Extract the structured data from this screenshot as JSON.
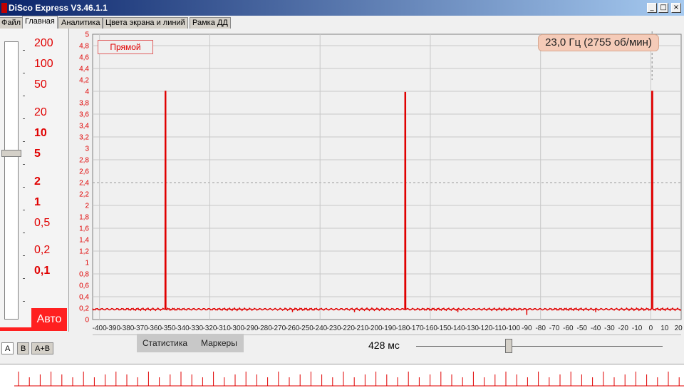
{
  "window": {
    "title": "DiSco Express V3.46.1.1",
    "min": "_",
    "max": "□",
    "close": "×"
  },
  "tabs": [
    {
      "label": "Файл"
    },
    {
      "label": "Главная"
    },
    {
      "label": "Аналитика"
    },
    {
      "label": "Цвета экрана и линий"
    },
    {
      "label": "Рамка ДД"
    }
  ],
  "left_panel": {
    "scale_labels": [
      "200",
      "100",
      "50",
      "20",
      "10",
      "5",
      "2",
      "1",
      "0,5",
      "0,2",
      "0,1"
    ],
    "auto_button": "Авто",
    "channel_tabs": [
      "A",
      "B",
      "A+B"
    ]
  },
  "chart_header": {
    "mode_label": "Прямой",
    "frequency": "23,0 Гц (2755 об/мин)"
  },
  "bottom_bar": {
    "stats_button": "Статистика",
    "markers_button": "Маркеры",
    "time_window": "428 мс"
  },
  "colors": {
    "trace": "#e00000",
    "accent": "#ff2020",
    "badge": "#f5cbb8"
  },
  "chart_data": {
    "type": "line",
    "ylim": [
      0,
      5
    ],
    "xlim": [
      -405,
      22
    ],
    "y_ticks": [
      "0",
      "0,2",
      "0,4",
      "0,6",
      "0,8",
      "1",
      "1,2",
      "1,4",
      "1,6",
      "1,8",
      "2",
      "2,2",
      "2,4",
      "2,6",
      "2,8",
      "3",
      "3,2",
      "3,4",
      "3,6",
      "3,8",
      "4",
      "4,2",
      "4,4",
      "4,6",
      "4,8",
      "5"
    ],
    "x_ticks": [
      "-400",
      "-390",
      "-380",
      "-370",
      "-360",
      "-350",
      "-340",
      "-330",
      "-320",
      "-310",
      "-300",
      "-290",
      "-280",
      "-270",
      "-260",
      "-250",
      "-240",
      "-230",
      "-220",
      "-210",
      "-200",
      "-190",
      "-180",
      "-170",
      "-160",
      "-150",
      "-140",
      "-130",
      "-120",
      "-110",
      "-100",
      "-90",
      "-80",
      "-70",
      "-60",
      "-50",
      "-40",
      "-30",
      "-20",
      "-10",
      "0",
      "10",
      "20"
    ],
    "series": [
      {
        "baseline": 0.18,
        "pulses": [
          {
            "start": -352.5,
            "end": -351.8,
            "peak": 4.0
          },
          {
            "start": -178.5,
            "end": -177.8,
            "peak": 3.98
          },
          {
            "start": 0.6,
            "end": 1.4,
            "peak": 4.0
          }
        ]
      }
    ],
    "grid": true
  }
}
